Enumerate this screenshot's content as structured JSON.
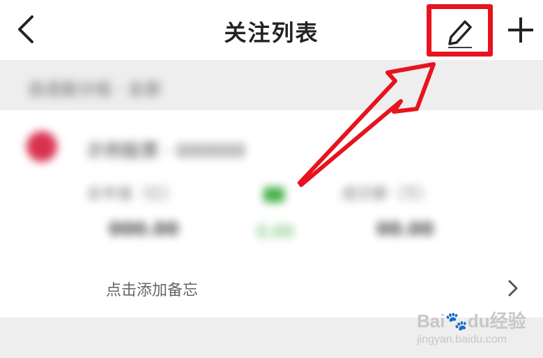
{
  "header": {
    "title": "关注列表"
  },
  "group": {
    "label": "自选股分组 · 全部"
  },
  "stock_card": {
    "name": "示例股票 · 000000",
    "metrics": [
      {
        "label": "总市值（亿）",
        "value": "000.00"
      },
      {
        "label": "成交额（万）",
        "value": "00.00"
      }
    ],
    "change_value": "0.00",
    "memo": "点击添加备忘"
  },
  "watermark": {
    "logo": "Bai🐾du经验",
    "url": "jingyan.baidu.com"
  },
  "colors": {
    "highlight": "#e6141e",
    "up_green": "#48b04a"
  }
}
